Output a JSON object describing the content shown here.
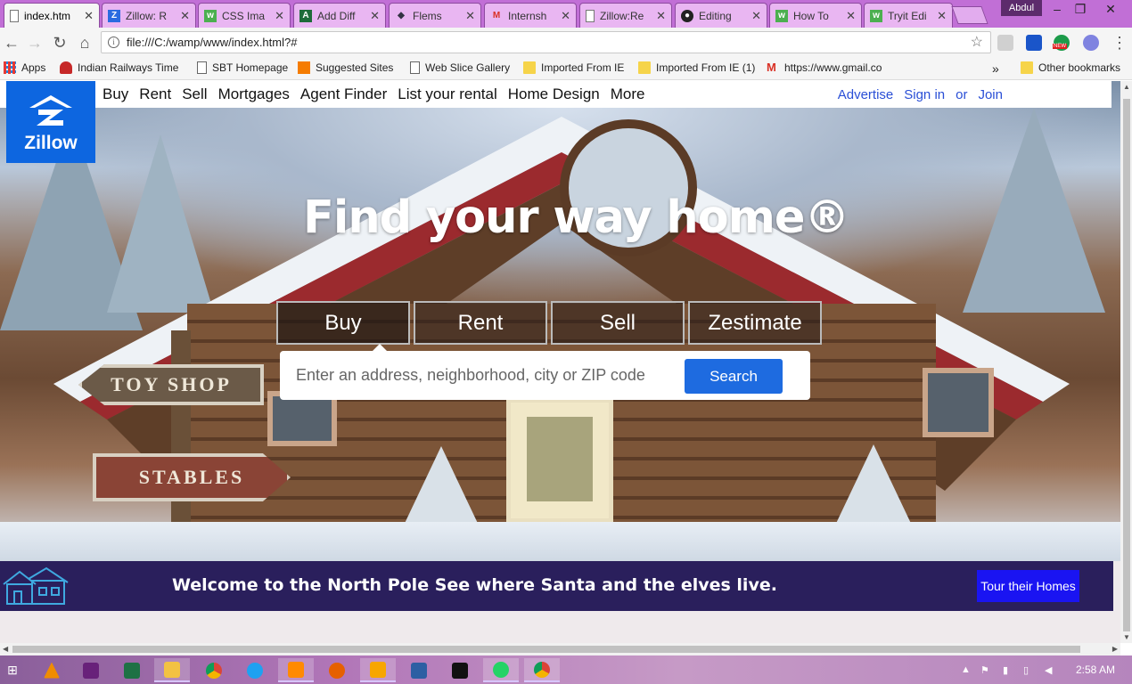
{
  "browser": {
    "tabs": [
      {
        "label": "index.htm",
        "active": true
      },
      {
        "label": "Zillow: R"
      },
      {
        "label": "CSS Ima"
      },
      {
        "label": "Add Diff"
      },
      {
        "label": "Flems"
      },
      {
        "label": "Internsh"
      },
      {
        "label": "Zillow:Re"
      },
      {
        "label": "Editing"
      },
      {
        "label": "How To"
      },
      {
        "label": "Tryit Edi"
      }
    ],
    "user": "Abdul",
    "url": "file:///C:/wamp/www/index.html?#",
    "bookmarks": [
      {
        "label": "Apps"
      },
      {
        "label": "Indian Railways Time"
      },
      {
        "label": "SBT Homepage"
      },
      {
        "label": "Suggested Sites"
      },
      {
        "label": "Web Slice Gallery"
      },
      {
        "label": "Imported From IE"
      },
      {
        "label": "Imported From IE (1)"
      },
      {
        "label": "https://www.gmail.co"
      },
      {
        "label": "Other bookmarks"
      }
    ],
    "more_bookmarks": "»",
    "ext_new_badge": "NEW"
  },
  "zillow": {
    "logo_text": "Zillow",
    "nav": [
      "Buy",
      "Rent",
      "Sell",
      "Mortgages",
      "Agent Finder",
      "List your rental",
      "Home Design",
      "More"
    ],
    "advertise": "Advertise",
    "sign_in": "Sign in",
    "or": "or",
    "join": "Join",
    "headline": "Find your way home®",
    "search_tabs": [
      "Buy",
      "Rent",
      "Sell",
      "Zestimate"
    ],
    "search_placeholder": "Enter an address, neighborhood, city or ZIP code",
    "search_button": "Search",
    "signs": {
      "toy_shop": "TOY SHOP",
      "stables": "STABLES"
    },
    "banner": {
      "message": "Welcome to the North Pole See where Santa and the elves live.",
      "button": "Tour their Homes"
    }
  },
  "taskbar": {
    "time": "2:58 AM"
  },
  "colors": {
    "zillow_blue": "#0d66e0",
    "banner_bg": "#2a1f5c",
    "tour_button": "#1a14f2",
    "tab_strip": "#c16fd6"
  }
}
